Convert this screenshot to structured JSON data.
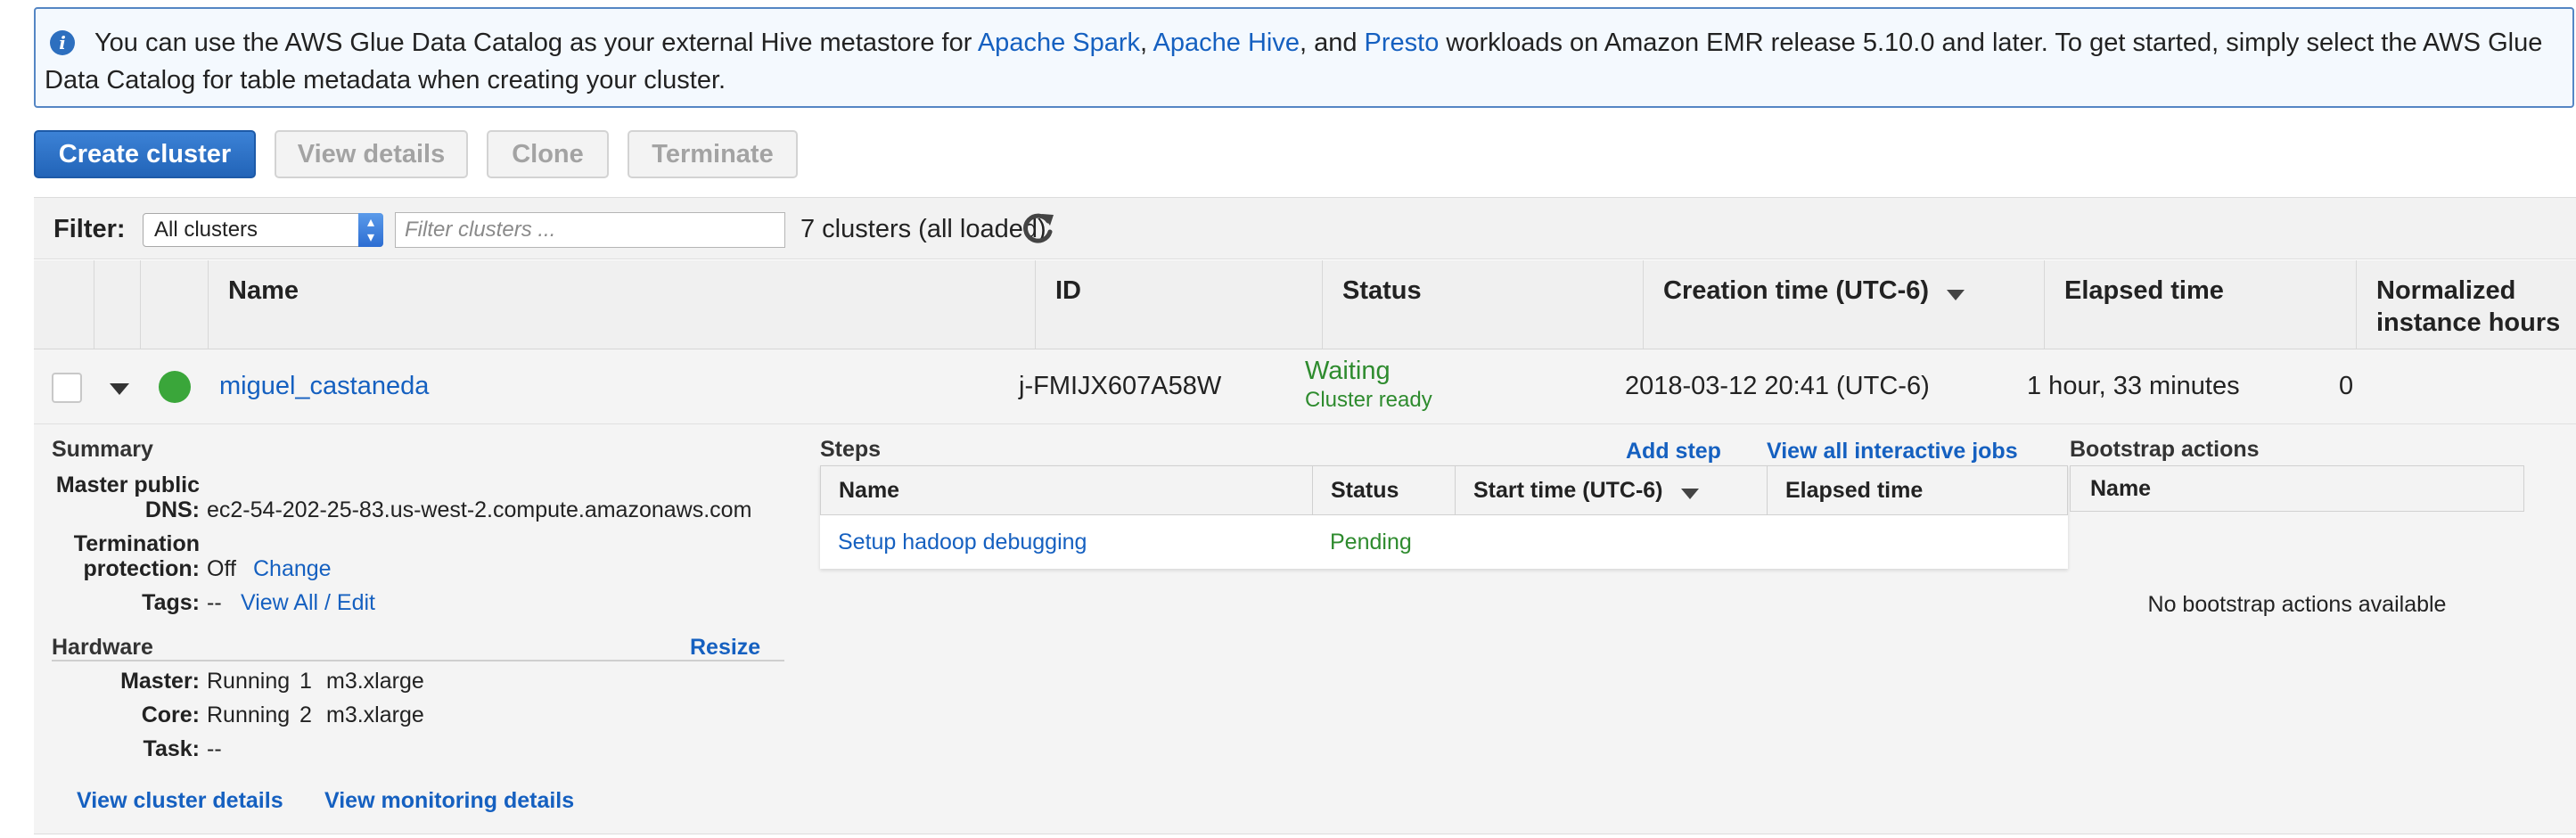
{
  "banner": {
    "text_1": "You can use the AWS Glue Data Catalog as your external Hive metastore for ",
    "link_spark": "Apache Spark",
    "sep_1": ", ",
    "link_hive": "Apache Hive",
    "sep_2": ", and ",
    "link_presto": "Presto",
    "text_2": " workloads on Amazon EMR release 5.10.0 and later. To get started, simply select the AWS Glue Data Catalog for table metadata when creating your cluster."
  },
  "toolbar": {
    "create": "Create cluster",
    "view_details": "View details",
    "clone": "Clone",
    "terminate": "Terminate"
  },
  "filter": {
    "label": "Filter:",
    "selected": "All clusters",
    "placeholder": "Filter clusters ...",
    "count": "7 clusters (all loaded)"
  },
  "table": {
    "headers": {
      "name": "Name",
      "id": "ID",
      "status": "Status",
      "creation": "Creation time (UTC-6)",
      "elapsed": "Elapsed time",
      "normalized_1": "Normalized",
      "normalized_2": "instance hours"
    },
    "row": {
      "name": "miguel_castaneda",
      "id": "j-FMIJX607A58W",
      "status": "Waiting",
      "status_detail": "Cluster ready",
      "creation": "2018-03-12 20:41 (UTC-6)",
      "elapsed": "1 hour, 33 minutes",
      "normalized": "0"
    }
  },
  "summary": {
    "title": "Summary",
    "dns_key_1": "Master public",
    "dns_key_2": "DNS:",
    "dns_val": "ec2-54-202-25-83.us-west-2.compute.amazonaws.com",
    "term_key_1": "Termination",
    "term_key_2": "protection:",
    "term_val": "Off",
    "term_link": "Change",
    "tags_key": "Tags:",
    "tags_val": "--",
    "tags_link": "View All / Edit"
  },
  "hardware": {
    "title": "Hardware",
    "resize": "Resize",
    "master_key": "Master:",
    "master_status": "Running",
    "master_count": "1",
    "master_type": "m3.xlarge",
    "core_key": "Core:",
    "core_status": "Running",
    "core_count": "2",
    "core_type": "m3.xlarge",
    "task_key": "Task:",
    "task_val": "--"
  },
  "links": {
    "cluster_details": "View cluster details",
    "monitoring": "View monitoring details"
  },
  "steps": {
    "title": "Steps",
    "add_step": "Add step",
    "view_jobs": "View all interactive jobs",
    "headers": {
      "name": "Name",
      "status": "Status",
      "start": "Start time (UTC-6)",
      "elapsed": "Elapsed time"
    },
    "row": {
      "name": "Setup hadoop debugging",
      "status": "Pending"
    }
  },
  "bootstrap": {
    "title": "Bootstrap actions",
    "header": "Name",
    "empty": "No bootstrap actions available"
  },
  "colors": {
    "primary": "#2264b8",
    "link": "#1560c0",
    "status_green": "#2e8b2e",
    "banner_border": "#5586c4"
  }
}
